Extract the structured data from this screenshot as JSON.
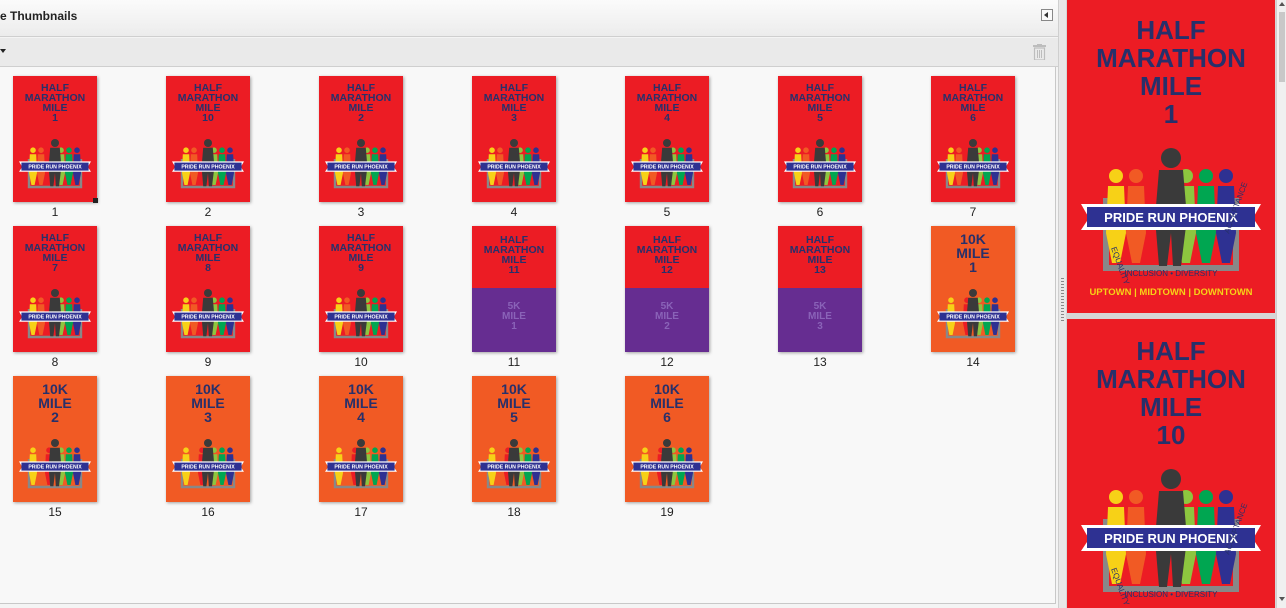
{
  "panel": {
    "title": "e Thumbnails",
    "collapse_icon": "collapse-left-icon",
    "options_icon": "dropdown-arrow-icon",
    "delete_icon": "trash-icon"
  },
  "thumbnails": [
    {
      "label": "1",
      "title": "HALF\nMARATHON\nMILE\n1",
      "color": "red",
      "selected": true
    },
    {
      "label": "2",
      "title": "HALF\nMARATHON\nMILE\n10",
      "color": "red"
    },
    {
      "label": "3",
      "title": "HALF\nMARATHON\nMILE\n2",
      "color": "red"
    },
    {
      "label": "4",
      "title": "HALF\nMARATHON\nMILE\n3",
      "color": "red"
    },
    {
      "label": "5",
      "title": "HALF\nMARATHON\nMILE\n4",
      "color": "red"
    },
    {
      "label": "6",
      "title": "HALF\nMARATHON\nMILE\n5",
      "color": "red"
    },
    {
      "label": "7",
      "title": "HALF\nMARATHON\nMILE\n6",
      "color": "red"
    },
    {
      "label": "8",
      "title": "HALF\nMARATHON\nMILE\n7",
      "color": "red"
    },
    {
      "label": "9",
      "title": "HALF\nMARATHON\nMILE\n8",
      "color": "red"
    },
    {
      "label": "10",
      "title": "HALF\nMARATHON\nMILE\n9",
      "color": "red"
    },
    {
      "label": "11",
      "title": "HALF\nMARATHON\nMILE\n11",
      "color": "split",
      "sub": "5K\nMILE\n1"
    },
    {
      "label": "12",
      "title": "HALF\nMARATHON\nMILE\n12",
      "color": "split",
      "sub": "5K\nMILE\n2"
    },
    {
      "label": "13",
      "title": "HALF\nMARATHON\nMILE\n13",
      "color": "split",
      "sub": "5K\nMILE\n3"
    },
    {
      "label": "14",
      "title": "10K\nMILE\n1",
      "color": "orange"
    },
    {
      "label": "15",
      "title": "10K\nMILE\n2",
      "color": "orange"
    },
    {
      "label": "16",
      "title": "10K\nMILE\n3",
      "color": "orange"
    },
    {
      "label": "17",
      "title": "10K\nMILE\n4",
      "color": "orange"
    },
    {
      "label": "18",
      "title": "10K\nMILE\n5",
      "color": "orange"
    },
    {
      "label": "19",
      "title": "10K\nMILE\n6",
      "color": "orange"
    }
  ],
  "preview": {
    "pages": [
      {
        "title": "HALF\nMARATHON\nMILE\n1",
        "banner": "PRIDE RUN PHOENIX",
        "ring_left": "EQUALITY",
        "ring_right": "ACCEPTANCE",
        "ring_bottom": "INCLUSION • DIVERSITY",
        "footer": "UPTOWN | MIDTOWN | DOWNTOWN"
      },
      {
        "title": "HALF\nMARATHON\nMILE\n10",
        "banner": "PRIDE RUN PHOENIX",
        "ring_left": "EQUALITY",
        "ring_right": "ACCEPTANCE",
        "ring_bottom": "INCLUSION • DIVERSITY"
      }
    ]
  },
  "logo_banner": "PRIDE RUN PHOENIX",
  "colors": {
    "red": "#ec1c24",
    "orange": "#f15a24",
    "purple": "#662d91",
    "navy": "#27306b",
    "yellow": "#f7d117"
  }
}
